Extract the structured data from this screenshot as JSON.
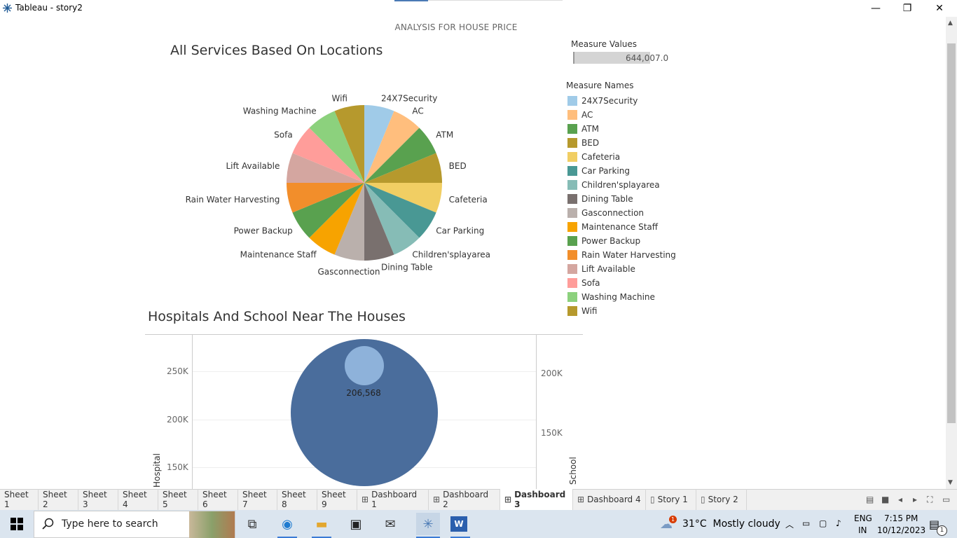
{
  "window": {
    "title": "Tableau - story2",
    "minimize": "—",
    "restore": "❐",
    "close": "✕"
  },
  "story": {
    "title": "ANALYSIS FOR HOUSE PRICE"
  },
  "pie": {
    "title": "All Services Based On Locations",
    "labels": [
      "24X7Security",
      "AC",
      "ATM",
      "BED",
      "Cafeteria",
      "Car Parking",
      "Children'splayarea",
      "Dining Table",
      "Gasconnection",
      "Maintenance Staff",
      "Power Backup",
      "Rain Water Harvesting",
      "Lift Available",
      "Sofa",
      "Washing Machine",
      "Wifi"
    ],
    "colors": [
      "#a0cbe8",
      "#ffbe7d",
      "#59a14f",
      "#b6992d",
      "#f1ce63",
      "#499894",
      "#86bcb6",
      "#79706e",
      "#bab0ac",
      "#f7a300",
      "#59a14f",
      "#f28e2b",
      "#d4a6a0",
      "#ff9d9a",
      "#8cd17d",
      "#b6992d"
    ]
  },
  "measure_values": {
    "title": "Measure Values",
    "value": "644,007.0"
  },
  "measure_names": {
    "title": "Measure Names"
  },
  "bubble": {
    "title": "Hospitals And School Near The Houses",
    "label": "206,568",
    "left_ticks": [
      "250K",
      "200K",
      "150K"
    ],
    "right_ticks": [
      "200K",
      "150K"
    ],
    "left_axis": "Hospital",
    "right_axis": "School",
    "colors": {
      "big": "#4a6d9c",
      "small": "#8eb2da"
    }
  },
  "tabs": [
    "Sheet 1",
    "Sheet 2",
    "Sheet 3",
    "Sheet 4",
    "Sheet 5",
    "Sheet 6",
    "Sheet 7",
    "Sheet 8",
    "Sheet 9",
    "Dashboard 1",
    "Dashboard 2",
    "Dashboard 3",
    "Dashboard 4",
    "Story 1",
    "Story 2"
  ],
  "active_tab": "Dashboard 3",
  "taskbar": {
    "search_placeholder": "Type here to search",
    "weather": "31°C  Mostly cloudy",
    "weather_badge": "1",
    "lang1": "ENG",
    "lang2": "IN",
    "time": "7:15 PM",
    "date": "10/12/2023",
    "notif_count": "1"
  }
}
